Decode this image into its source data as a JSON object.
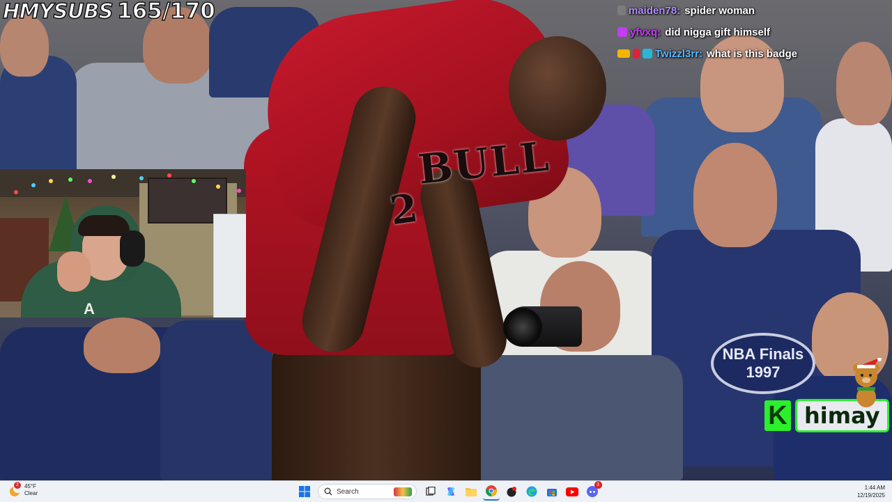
{
  "overlay": {
    "subgoal_label": "HMYSUBS",
    "subgoal_count": "165/170"
  },
  "chat": [
    {
      "user": "maiden78:",
      "message": "spider woman",
      "color": "#b18cff"
    },
    {
      "user": "yfvxq:",
      "message": "did nigga gift himself",
      "color": "#c23cf0"
    },
    {
      "user": "Twizzl3rr:",
      "message": "what is this badge",
      "color": "#58b7ff"
    }
  ],
  "photo": {
    "jersey_text": "BULL",
    "jersey_number": "2",
    "finals_logo": "NBA Finals 1997"
  },
  "brand": {
    "k": "K",
    "name": "himay"
  },
  "webcam": {
    "hoodie_logo": "A"
  },
  "taskbar": {
    "weather_temp": "45°F",
    "weather_cond": "Clear",
    "weather_alert_count": "2",
    "search_placeholder": "Search",
    "time": "1:44 AM",
    "date": "12/19/2025",
    "discord_badge": "3"
  },
  "colors": {
    "accent_green": "#2cf02c",
    "taskbar_bg": "#eef1f6",
    "bulls_red": "#c5192d"
  },
  "icons": [
    "start-icon",
    "search-icon",
    "gift-icon",
    "task-view-icon",
    "copilot-icon",
    "file-explorer-icon",
    "chrome-icon",
    "game-icon",
    "edge-icon",
    "store-icon",
    "youtube-icon",
    "discord-icon"
  ]
}
